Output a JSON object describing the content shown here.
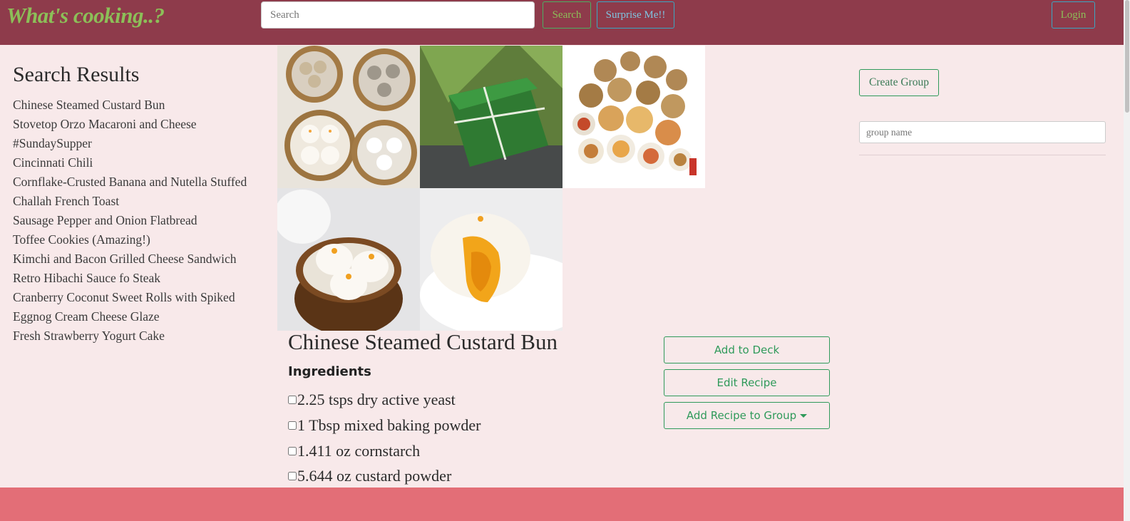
{
  "navbar": {
    "brand": "What's cooking..?",
    "search_placeholder": "Search",
    "search_button": "Search",
    "surprise_button": "Surprise Me!!",
    "login_button": "Login"
  },
  "results": {
    "title": "Search Results",
    "items": [
      "Chinese Steamed Custard Bun",
      "Stovetop Orzo Macaroni and Cheese",
      "#SundaySupper",
      "Cincinnati Chili",
      "Cornflake-Crusted Banana and Nutella Stuffed",
      "Challah French Toast",
      "Sausage Pepper and Onion Flatbread",
      "Toffee Cookies (Amazing!)",
      "Kimchi and Bacon Grilled Cheese Sandwich",
      "Retro Hibachi Sauce fo Steak",
      "Cranberry Coconut Sweet Rolls with Spiked",
      "Eggnog Cream Cheese Glaze",
      "Fresh Strawberry Yogurt Cake"
    ]
  },
  "recipe": {
    "title": "Chinese Steamed Custard Bun",
    "ingredients_heading": "Ingredients",
    "ingredients": [
      "2.25 tsps dry active yeast",
      "1 Tbsp mixed baking powder",
      "1.411 oz cornstarch",
      "5.644 oz custard powder"
    ],
    "actions": {
      "add_to_deck": "Add to Deck",
      "edit_recipe": "Edit Recipe",
      "add_to_group": "Add Recipe to Group"
    }
  },
  "groups": {
    "create_button": "Create Group",
    "name_placeholder": "group name"
  },
  "colors": {
    "navbar": "#8e3b4b",
    "brand": "#8cbf58",
    "page_background": "#f8e9ea",
    "footer": "#e36e77",
    "button_green": "#2f9a5a"
  },
  "icons": {
    "add_to_group_button": "caret-down-icon"
  }
}
